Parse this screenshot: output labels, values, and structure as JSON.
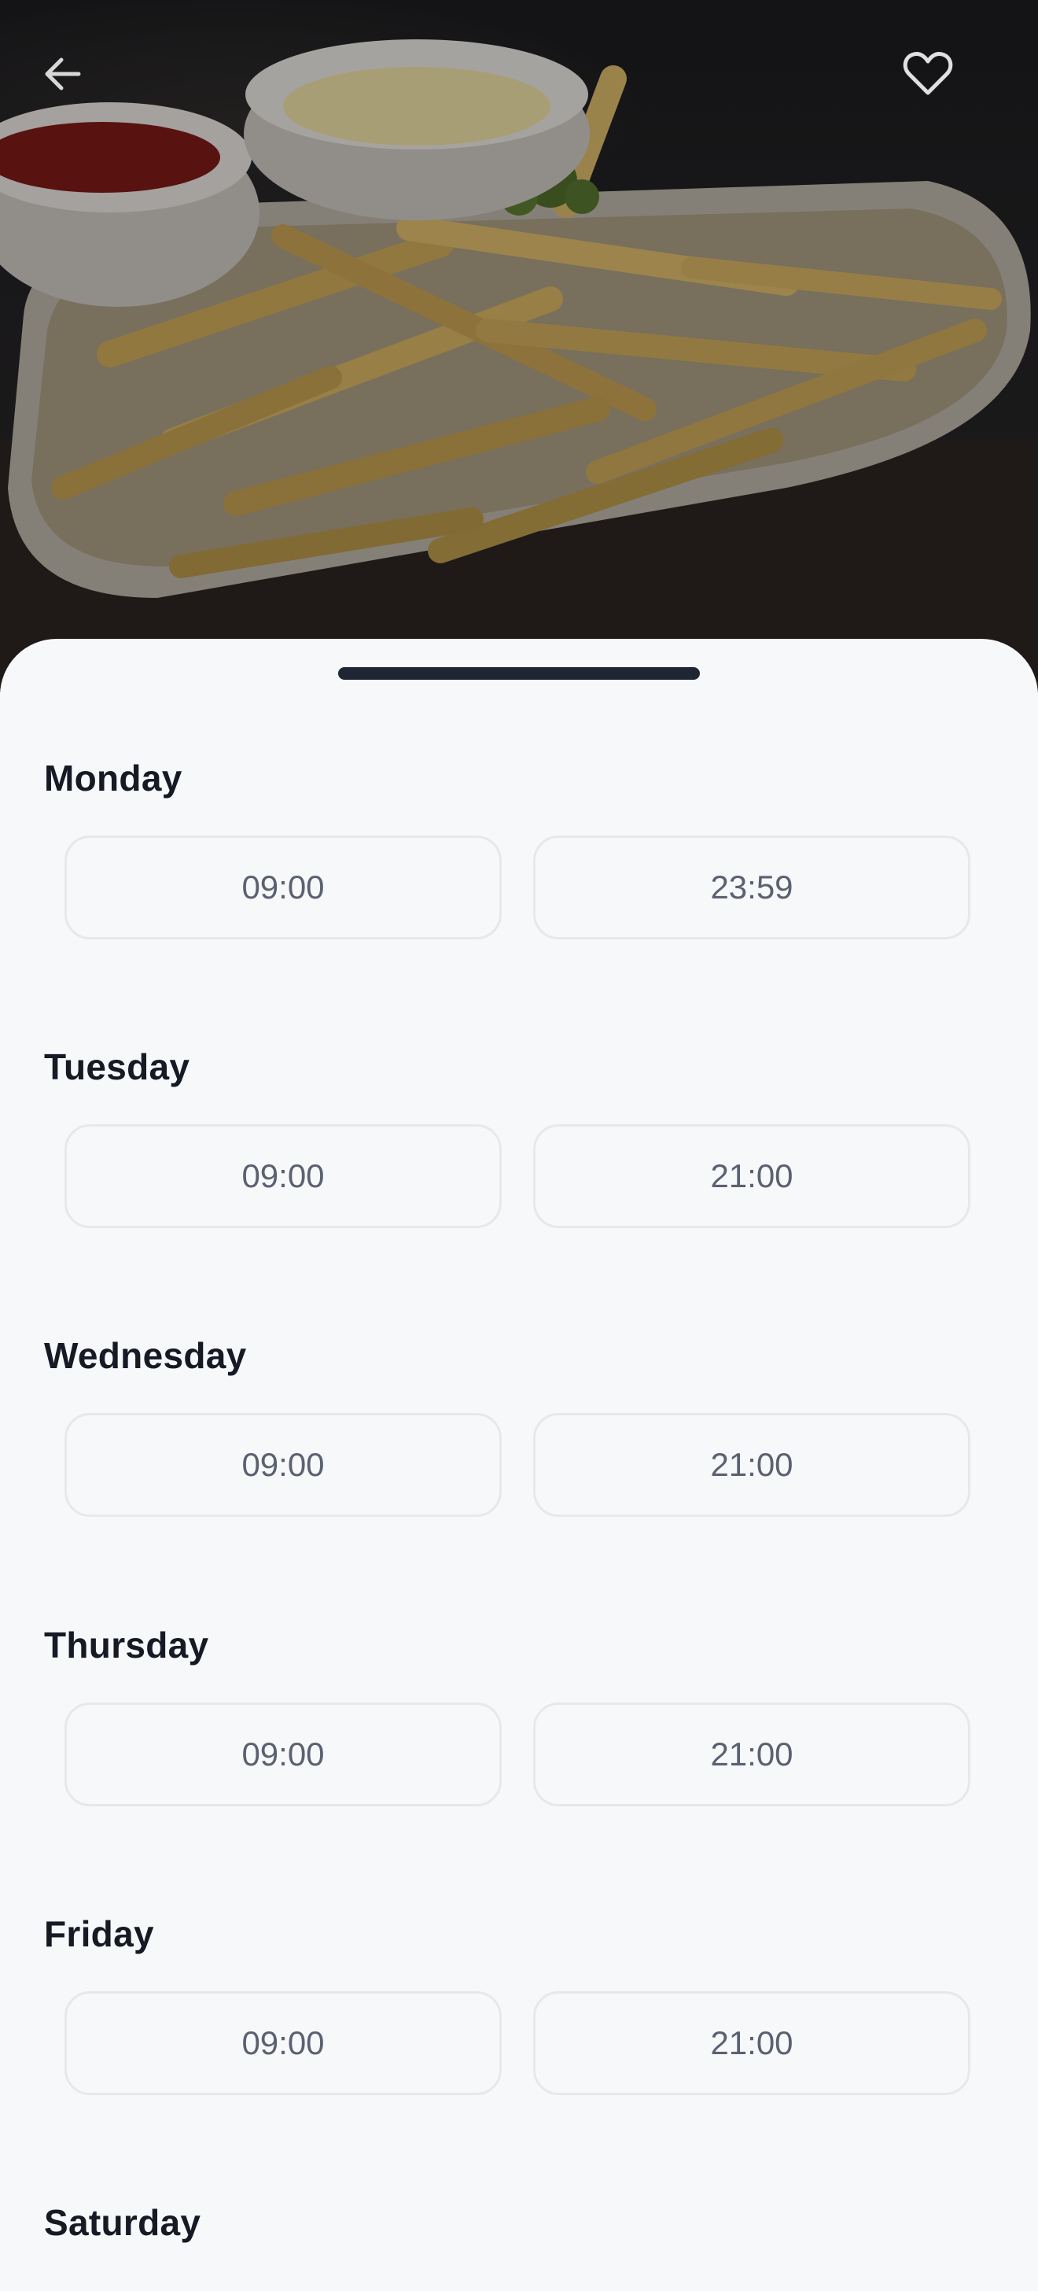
{
  "header": {
    "back_icon": "arrow-left-icon",
    "favorite_icon": "heart-outline-icon",
    "hero_image": "french fries with ketchup and mayonnaise dips"
  },
  "schedule": [
    {
      "day": "Monday",
      "open": "09:00",
      "close": "23:59"
    },
    {
      "day": "Tuesday",
      "open": "09:00",
      "close": "21:00"
    },
    {
      "day": "Wednesday",
      "open": "09:00",
      "close": "21:00"
    },
    {
      "day": "Thursday",
      "open": "09:00",
      "close": "21:00"
    },
    {
      "day": "Friday",
      "open": "09:00",
      "close": "21:00"
    },
    {
      "day": "Saturday"
    }
  ],
  "colors": {
    "sheet_background": "#f7f8fa",
    "day_label": "#151a24",
    "time_text": "#5b6170",
    "time_border": "#e6e8ec",
    "grabber": "#1f2633"
  }
}
